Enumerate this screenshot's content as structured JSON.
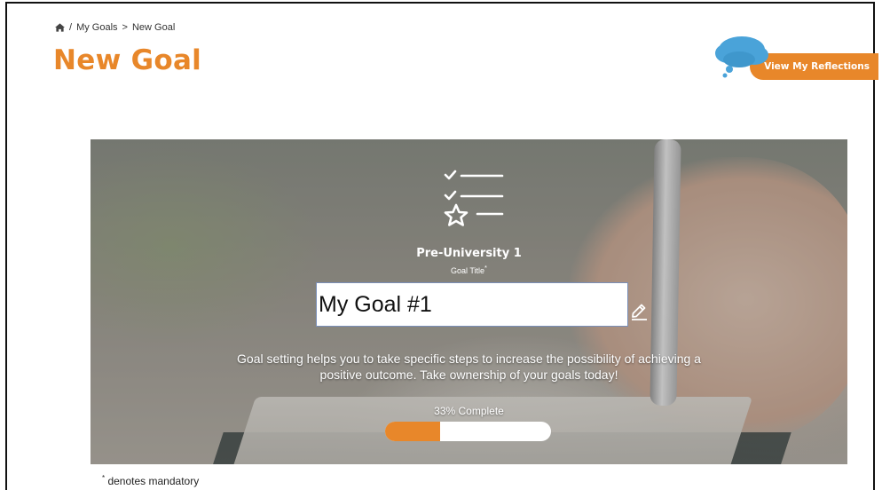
{
  "breadcrumb": {
    "icon": "home-icon",
    "separator1": "/",
    "my_goals": "My Goals",
    "separator2": ">",
    "current": "New Goal"
  },
  "page": {
    "title": "New Goal"
  },
  "reflections": {
    "icon": "thought-cloud-icon",
    "label": "View My Reflections"
  },
  "hero": {
    "icon": "checklist-star-icon",
    "course": "Pre-University 1",
    "field_label": "Goal Title",
    "field_required_mark": "*",
    "goal_title_value": "My Goal #1",
    "edit_icon": "pencil-icon",
    "description": "Goal setting helps you to take specific steps to increase the possibility of achieving a positive outcome. Take ownership of your goals today!",
    "progress_label": "33% Complete",
    "progress_fraction": 0.33
  },
  "footnote": {
    "mark": "*",
    "text": " denotes mandatory"
  },
  "colors": {
    "accent": "#e8872a",
    "cloud": "#4aa3d9"
  }
}
